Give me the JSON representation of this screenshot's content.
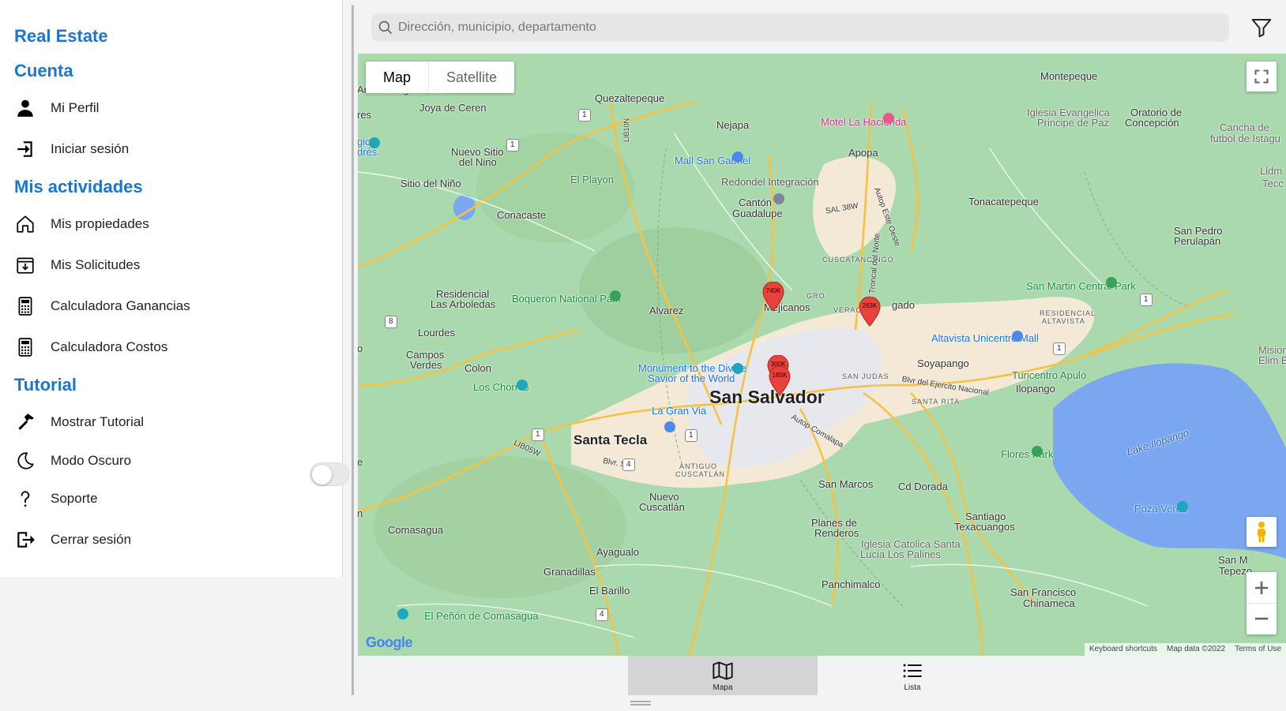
{
  "sidebar": {
    "app_title": "Real Estate",
    "sections": {
      "cuenta": "Cuenta",
      "mis_actividades": "Mis actividades",
      "tutorial": "Tutorial"
    },
    "items": {
      "mi_perfil": "Mi Perfil",
      "iniciar_sesion": "Iniciar sesión",
      "mis_propiedades": "Mis propiedades",
      "mis_solicitudes": "Mis Solicitudes",
      "calc_ganancias": "Calculadora Ganancias",
      "calc_costos": "Calculadora Costos",
      "mostrar_tutorial": "Mostrar Tutorial",
      "modo_oscuro": "Modo Oscuro",
      "soporte": "Soporte",
      "cerrar_sesion": "Cerrar sesión"
    },
    "dark_mode_enabled": false
  },
  "search": {
    "placeholder": "Dirección, municipio, departamento",
    "value": ""
  },
  "map": {
    "type_buttons": {
      "map": "Map",
      "satellite": "Satellite"
    },
    "selected_type": "Map",
    "markers": [
      "740K",
      "263K",
      "300K",
      "185K"
    ],
    "attribution": {
      "shortcuts": "Keyboard shortcuts",
      "data": "Map data ©2022",
      "terms": "Terms of Use"
    },
    "logo": "Google",
    "labels": {
      "archaeological": "Archaeological Site",
      "joya": "Joya de Ceren",
      "quezaltepeque": "Quezaltepeque",
      "nejapa": "Nejapa",
      "motel": "Motel La Hacienda",
      "apopa": "Apopa",
      "montepeque": "Montepeque",
      "iglesia_evangelica": "Iglesia Evangelica",
      "principe_paz": "Principe de Paz",
      "oratorio": "Oratorio de",
      "concepcion": "Concepción",
      "cancha": "Cancha de",
      "futbol": "futbol de Istagu",
      "nuevo_sitio": "Nuevo Sitio",
      "del_nino": "del Nino",
      "mall": "Mall San Gabriel",
      "redondel": "Redondel Integración",
      "el_playon": "El Playon",
      "sitio_nino": "Sitio del Niño",
      "canton": "Cantón",
      "guadalupe": "Guadalupe",
      "conacaste": "Conacaste",
      "tonacatepeque": "Tonacatepeque",
      "san_pedro": "San Pedro",
      "perulapan": "Perulapán",
      "cuscatancingo": "CUSCATANCINGO",
      "residencial": "Residencial",
      "arboledas": "Las Arboledas",
      "boqueron": "Boqueron National Park",
      "el_pro": "EL",
      "grogro": "GRO",
      "mejicanos": "Mejicanos",
      "veracruz": "VERACRUZ",
      "delgado": "gado",
      "san_martin": "San Martin Central Park",
      "alvarez": "Alvarez",
      "residencial2": "RESIDENCIAL",
      "altavista2": "ALTAVISTA",
      "altavista": "Altavista Unicentro Mall",
      "lourdes": "Lourdes",
      "campos": "Campos",
      "verdes": "Verdes",
      "colon": "Colon",
      "monument": "Monument to the Divine",
      "savior": "Savior of the World",
      "san_judas": "SAN JUDAS",
      "soyapango": "Soyapango",
      "turicentro": "Turicentro Apulo",
      "ilopango": "Ilopango",
      "los_chorros": "Los Chorros",
      "mision": "Mision",
      "elim": "Elim Bu",
      "blvr_ejercito": "Blvr del Ejercito Nacional",
      "santa_rita": "SANTA RITA",
      "la_gran_via": "La Gran Via",
      "san_salvador": "San Salvador",
      "santa_tecla": "Santa Tecla",
      "flores_park": "Flores Park",
      "lake": "Lake Ilopango",
      "antiguo": "ANTIGUO",
      "cuscatlan": "CUSCATLÁN",
      "san_marcos": "San Marcos",
      "cd_dorada": "Cd Dorada",
      "nuevo_cusc": "Nuevo",
      "cuscatlan2": "Cuscatlán",
      "santiago": "Santiago",
      "texacuangos": "Texacuangos",
      "poza": "Poza Verde",
      "comasagua": "Comasagua",
      "planes": "Planes de",
      "renderos": "Renderos",
      "iglesia_cat": "Iglesia Catolica Santa",
      "lucia": "Lucia Los Palines",
      "ayagualo": "Ayagualo",
      "granadillas": "Granadillas",
      "el_barillo": "El Barillo",
      "panchimalco": "Panchimalco",
      "san_francisco": "San Francisco",
      "chinameca": "Chinameca",
      "san_miguel_t": "San M",
      "tepezo": "Tepezo",
      "penon": "El Peñón de Comasagua",
      "lldm": "Lldm",
      "tec": "Tecc",
      "ecos": "res",
      "gico": "gico",
      "dres": "drés",
      "o_l": "o",
      "n_l": "n",
      "e_l": "e",
      "autop_comalapa": "Autop Comalapa",
      "sal38w": "SAL 38W",
      "blvr_sur": "Blvr. Sur",
      "lib05w": "LIB05W",
      "lib10n": "LIB10N",
      "autop_este": "Autop Este Oeste",
      "troncal": "Carr Troncal del Norte"
    },
    "route_shields": [
      "1",
      "1",
      "1",
      "8",
      "1",
      "1",
      "1",
      "4",
      "4",
      "1"
    ]
  },
  "tabs": {
    "mapa": "Mapa",
    "lista": "Lista",
    "active": "Mapa"
  }
}
